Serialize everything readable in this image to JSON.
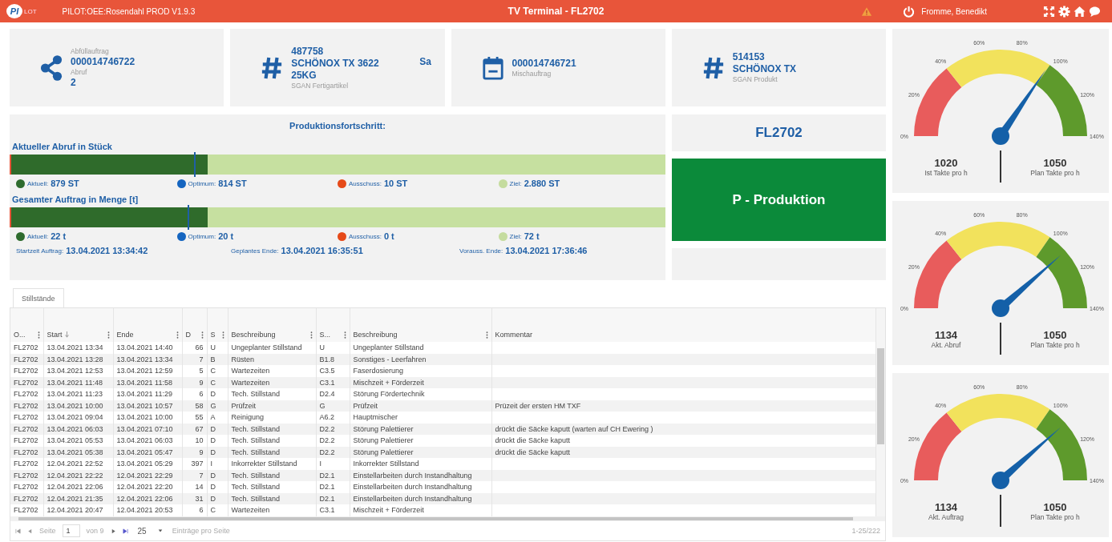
{
  "header": {
    "logo": {
      "main": "PI",
      "suffix": "LOT"
    },
    "app_title": "PILOT:OEE:Rosendahl PROD V1.9.3",
    "title": "TV Terminal - FL2702",
    "user": "Fromme, Benedikt"
  },
  "cards": [
    {
      "kind": "share",
      "lines": [
        {
          "kind": "label",
          "text": "Abfüllauftrag"
        },
        {
          "kind": "value",
          "text": "000014746722"
        },
        {
          "kind": "label",
          "text": "Abruf"
        },
        {
          "kind": "value",
          "text": "2"
        }
      ]
    },
    {
      "kind": "hash",
      "side": "Sa",
      "lines": [
        {
          "kind": "value",
          "text": "487758"
        },
        {
          "kind": "value",
          "text": "SCHÖNOX TX 3622"
        },
        {
          "kind": "value",
          "text": "25KG"
        },
        {
          "kind": "label",
          "text": "SGAN Fertigartikel"
        }
      ]
    },
    {
      "kind": "calendar",
      "lines": [
        {
          "kind": "value",
          "text": "000014746721"
        },
        {
          "kind": "label",
          "text": "Mischauftrag"
        }
      ]
    },
    {
      "kind": "hash",
      "lines": [
        {
          "kind": "value",
          "text": "514153"
        },
        {
          "kind": "value",
          "text": "SCHÖNOX TX"
        },
        {
          "kind": "label",
          "text": "SGAN Produkt"
        }
      ]
    }
  ],
  "progress": {
    "title": "Produktionsfortschritt:",
    "sections": [
      {
        "title": "Aktueller Abruf in Stück",
        "level": 0.3,
        "marker": {
          "level": 0.28
        },
        "legend": [
          {
            "label": "Aktuell:",
            "value": "879 ST",
            "color": "#2e6b2e"
          },
          {
            "label": "Optimum:",
            "value": "814 ST",
            "color": "#1565c0"
          },
          {
            "label": "Ausschuss:",
            "value": "10 ST",
            "color": "#e64a19"
          },
          {
            "label": "Ziel:",
            "value": "2.880 ST",
            "color": "#c5dc9e"
          }
        ]
      },
      {
        "title": "Gesamter Auftrag in Menge [t]",
        "level": 0.3,
        "marker": {
          "level": 0.27
        },
        "legend": [
          {
            "label": "Aktuell:",
            "value": "22 t",
            "color": "#2e6b2e"
          },
          {
            "label": "Optimum:",
            "value": "20 t",
            "color": "#1565c0"
          },
          {
            "label": "Ausschuss:",
            "value": "0 t",
            "color": "#e64a19"
          },
          {
            "label": "Ziel:",
            "value": "72 t",
            "color": "#c5dc9e"
          }
        ]
      }
    ],
    "times": [
      {
        "label": "Startzeit Auftrag:",
        "value": "13.04.2021 13:34:42"
      },
      {
        "label": "Geplantes Ende:",
        "value": "13.04.2021 16:35:51"
      },
      {
        "label": "Vorauss. Ende:",
        "value": "13.04.2021 17:36:46"
      }
    ]
  },
  "machine": "FL2702",
  "status": "P - Produktion",
  "tabs": [
    {
      "label": "Stillstände",
      "selected": true
    }
  ],
  "table": {
    "columns": [
      "O...",
      "Start",
      "Ende",
      "D",
      "S",
      "Beschreibung",
      "S...",
      "Beschreibung",
      "Kommentar"
    ],
    "rows": [
      [
        "FL2702",
        "13.04.2021 13:34",
        "13.04.2021 14:40",
        "66",
        "U",
        "Ungeplanter Stillstand",
        "U",
        "Ungeplanter Stillstand"
      ],
      [
        "FL2702",
        "13.04.2021 13:28",
        "13.04.2021 13:34",
        "7",
        "B",
        "Rüsten",
        "B1.8",
        "Sonstiges - Leerfahren"
      ],
      [
        "FL2702",
        "13.04.2021 12:53",
        "13.04.2021 12:59",
        "5",
        "C",
        "Wartezeiten",
        "C3.5",
        "Faserdosierung"
      ],
      [
        "FL2702",
        "13.04.2021 11:48",
        "13.04.2021 11:58",
        "9",
        "C",
        "Wartezeiten",
        "C3.1",
        "Mischzeit + Förderzeit"
      ],
      [
        "FL2702",
        "13.04.2021 11:23",
        "13.04.2021 11:29",
        "6",
        "D",
        "Tech. Stillstand",
        "D2.4",
        "Störung Fördertechnik"
      ],
      [
        "FL2702",
        "13.04.2021 10:00",
        "13.04.2021 10:57",
        "58",
        "G",
        "Prüfzeit",
        "G",
        "Prüfzeit",
        "Prüzeit der ersten HM TXF"
      ],
      [
        "FL2702",
        "13.04.2021 09:04",
        "13.04.2021 10:00",
        "55",
        "A",
        "Reinigung",
        "A6.2",
        "Hauptmischer"
      ],
      [
        "FL2702",
        "13.04.2021 06:03",
        "13.04.2021 07:10",
        "67",
        "D",
        "Tech. Stillstand",
        "D2.2",
        "Störung Palettierer",
        "drückt die Säcke kaputt (warten auf CH Ewering )"
      ],
      [
        "FL2702",
        "13.04.2021 05:53",
        "13.04.2021 06:03",
        "10",
        "D",
        "Tech. Stillstand",
        "D2.2",
        "Störung Palettierer",
        "drückt die Säcke kaputt"
      ],
      [
        "FL2702",
        "13.04.2021 05:38",
        "13.04.2021 05:47",
        "9",
        "D",
        "Tech. Stillstand",
        "D2.2",
        "Störung Palettierer",
        "drückt die Säcke kaputt"
      ],
      [
        "FL2702",
        "12.04.2021 22:52",
        "13.04.2021 05:29",
        "397",
        "I",
        "Inkorrekter Stillstand",
        "I",
        "Inkorrekter Stillstand"
      ],
      [
        "FL2702",
        "12.04.2021 22:22",
        "12.04.2021 22:29",
        "7",
        "D",
        "Tech. Stillstand",
        "D2.1",
        "Einstellarbeiten durch Instandhaltung"
      ],
      [
        "FL2702",
        "12.04.2021 22:06",
        "12.04.2021 22:20",
        "14",
        "D",
        "Tech. Stillstand",
        "D2.1",
        "Einstellarbeiten durch Instandhaltung"
      ],
      [
        "FL2702",
        "12.04.2021 21:35",
        "12.04.2021 22:06",
        "31",
        "D",
        "Tech. Stillstand",
        "D2.1",
        "Einstellarbeiten durch Instandhaltung"
      ],
      [
        "FL2702",
        "12.04.2021 20:47",
        "12.04.2021 20:53",
        "6",
        "C",
        "Wartezeiten",
        "C3.1",
        "Mischzeit + Förderzeit"
      ]
    ]
  },
  "pager": {
    "page_label": "Seite",
    "page": "1",
    "of": "von 9",
    "page_size": "25",
    "page_size_label": "Einträge pro Seite",
    "range": "1-25/222"
  },
  "gauges": [
    {
      "ticks": [
        "0%",
        "20%",
        "40%",
        "60%",
        "80%",
        "100%",
        "120%",
        "140%"
      ],
      "stats": [
        {
          "value": "1020",
          "label": "Ist Takte pro h"
        },
        {
          "value": "1050",
          "label": "Plan Takte pro h"
        }
      ]
    },
    {
      "ticks": [
        "0%",
        "20%",
        "40%",
        "60%",
        "80%",
        "100%",
        "120%",
        "140%"
      ],
      "stats": [
        {
          "value": "1134",
          "label": "Akt. Abruf"
        },
        {
          "value": "1050",
          "label": "Plan Takte pro h"
        }
      ]
    },
    {
      "ticks": [
        "0%",
        "20%",
        "40%",
        "60%",
        "80%",
        "100%",
        "120%",
        "140%"
      ],
      "stats": [
        {
          "value": "1134",
          "label": "Akt. Auftrag"
        },
        {
          "value": "1050",
          "label": "Plan Takte pro h"
        }
      ]
    }
  ]
}
